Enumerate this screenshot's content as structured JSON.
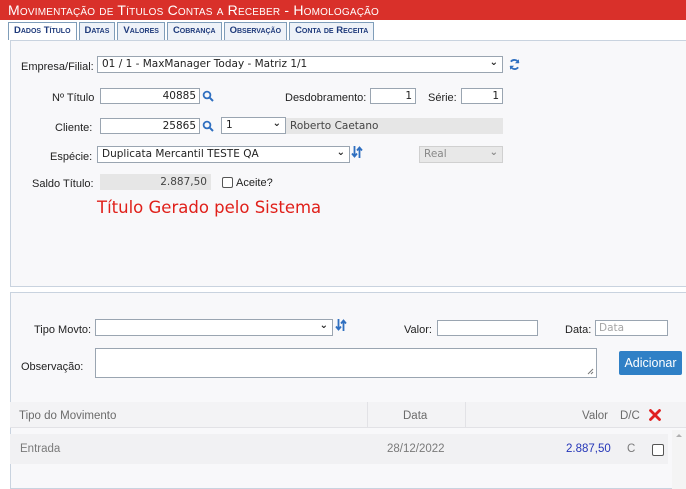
{
  "window": {
    "title": "Movimentação de Títulos Contas a Receber  - Homologação"
  },
  "tabs": [
    {
      "label": "Dados Título",
      "active": true
    },
    {
      "label": "Datas"
    },
    {
      "label": "Valores"
    },
    {
      "label": "Cobrança"
    },
    {
      "label": "Observação"
    },
    {
      "label": "Conta de Receita"
    }
  ],
  "form": {
    "empresa_label": "Empresa/Filial:",
    "empresa_value": "01 / 1 - MaxManager Today - Matriz 1/1",
    "numero_label": "Nº Título",
    "numero_value": "40885",
    "desdobramento_label": "Desdobramento:",
    "desdobramento_value": "1",
    "serie_label": "Série:",
    "serie_value": "1",
    "cliente_label": "Cliente:",
    "cliente_code": "25865",
    "cliente_select": "1",
    "cliente_name": "Roberto Caetano",
    "especie_label": "Espécie:",
    "especie_value": "Duplicata Mercantil TESTE QA",
    "moeda_value": "Real",
    "saldo_label": "Saldo Título:",
    "saldo_value": "2.887,50",
    "aceite_label": "Aceite?",
    "message": "Título Gerado pelo Sistema"
  },
  "movimento": {
    "tipo_label": "Tipo Movto:",
    "tipo_value": "",
    "valor_label": "Valor:",
    "valor_value": "",
    "data_label": "Data:",
    "data_placeholder": "Data",
    "observacao_label": "Observação:",
    "add_button": "Adicionar"
  },
  "table": {
    "headers": {
      "tipo": "Tipo do Movimento",
      "data": "Data",
      "valor": "Valor",
      "dc": "D/C"
    },
    "rows": [
      {
        "tipo": "Entrada",
        "data": "28/12/2022",
        "valor": "2.887,50",
        "dc": "C"
      }
    ]
  },
  "colors": {
    "title_bar": "#d9302a",
    "accent": "#2f80c6",
    "message": "#e0201a",
    "delete": "#e02020"
  },
  "icons": {
    "search": "search-icon",
    "refresh": "refresh-icon",
    "delete": "delete-all-icon"
  }
}
